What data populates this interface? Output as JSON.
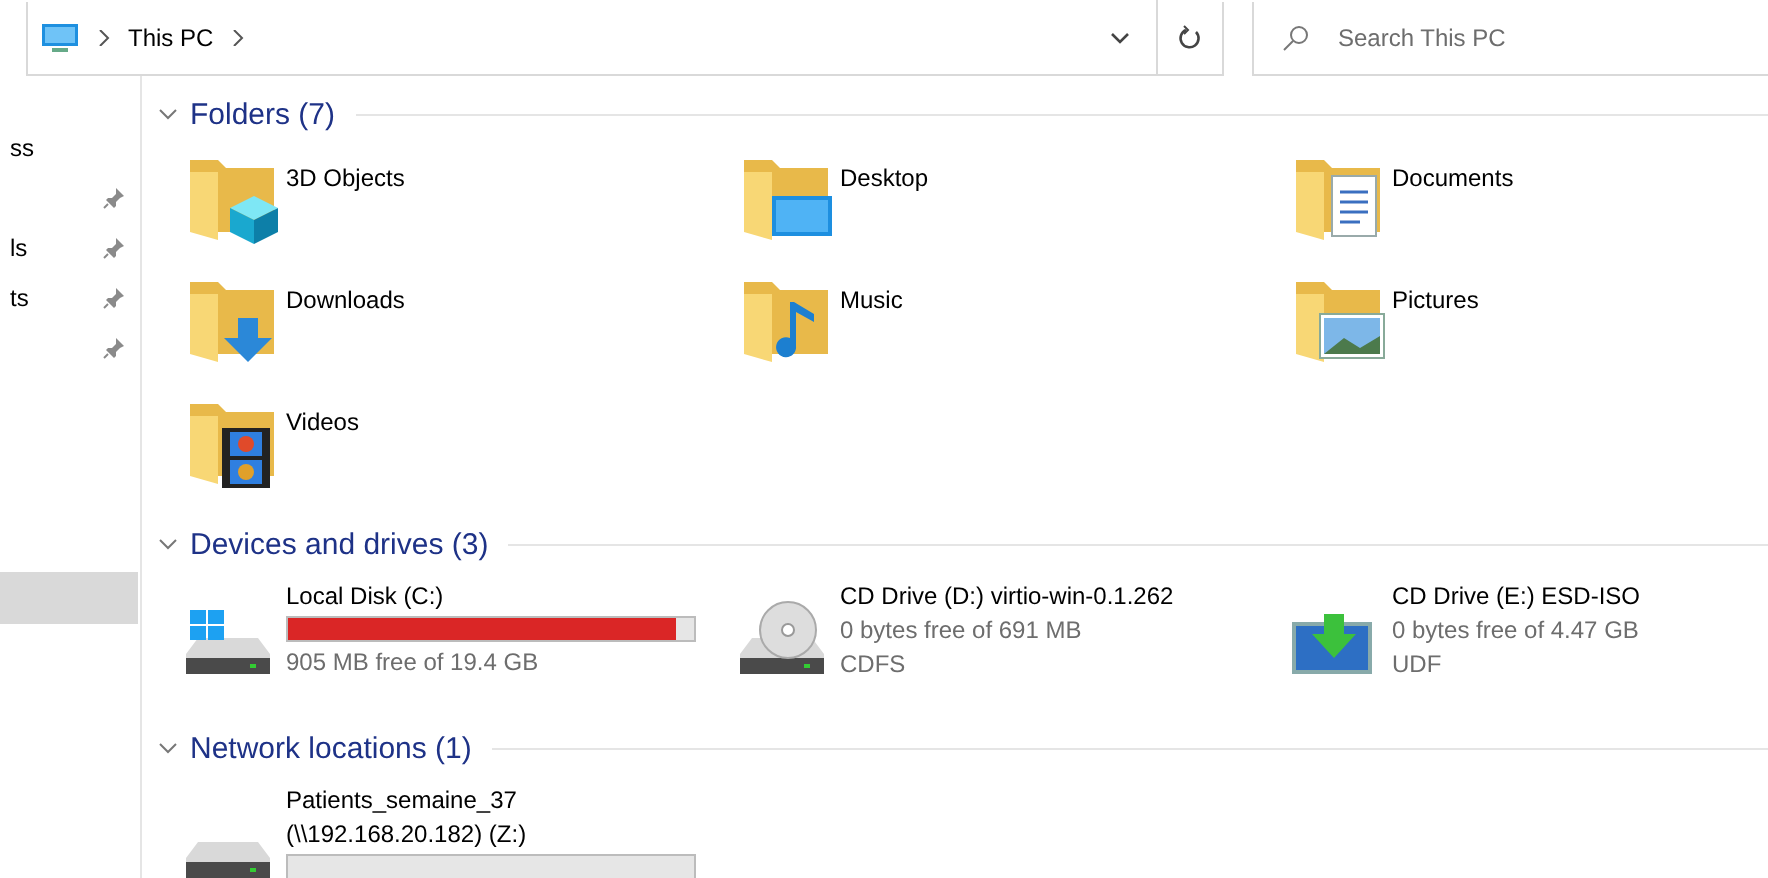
{
  "address_bar": {
    "crumbs": [
      "This PC"
    ],
    "search": {
      "placeholder": "Search This PC"
    }
  },
  "sidebar": {
    "sections": [
      {
        "items": [
          {
            "label": "ss",
            "pinned": false,
            "selected": false
          },
          {
            "pinned": true,
            "selected": false
          },
          {
            "label": "ls",
            "pinned": true,
            "selected": false
          },
          {
            "label": "ts",
            "pinned": true,
            "selected": false
          },
          {
            "pinned": true,
            "selected": false
          }
        ]
      },
      {
        "items": [
          {
            "pinned": false,
            "selected": true
          }
        ]
      }
    ]
  },
  "groups": [
    {
      "title": "Folders (7)",
      "expanded": true,
      "kind": "folders",
      "items": [
        {
          "name": "3D Objects",
          "kind": "objects"
        },
        {
          "name": "Desktop",
          "kind": "desktop"
        },
        {
          "name": "Documents",
          "kind": "documents"
        },
        {
          "name": "Downloads",
          "kind": "downloads"
        },
        {
          "name": "Music",
          "kind": "music"
        },
        {
          "name": "Pictures",
          "kind": "pictures"
        },
        {
          "name": "Videos",
          "kind": "videos"
        }
      ]
    },
    {
      "title": "Devices and drives (3)",
      "expanded": true,
      "kind": "drives",
      "items": [
        {
          "name": "Local Disk (C:)",
          "kind": "disk",
          "level": 0.955,
          "free": "905 MB free of 19.4 GB"
        },
        {
          "name": "CD Drive (D:) virtio-win-0.1.262",
          "kind": "cd",
          "free": "0 bytes free of 691 MB",
          "filesystem": "CDFS"
        },
        {
          "name": "CD Drive (E:) ESD-ISO",
          "kind": "image",
          "free": "0 bytes free of 4.47 GB",
          "filesystem": "UDF"
        }
      ]
    },
    {
      "title": "Network locations (1)",
      "expanded": true,
      "kind": "drives",
      "items": [
        {
          "name": "Patients_semaine_37",
          "path": "(\\\\192.168.20.182) (Z:)",
          "kind": "network"
        }
      ]
    }
  ]
}
